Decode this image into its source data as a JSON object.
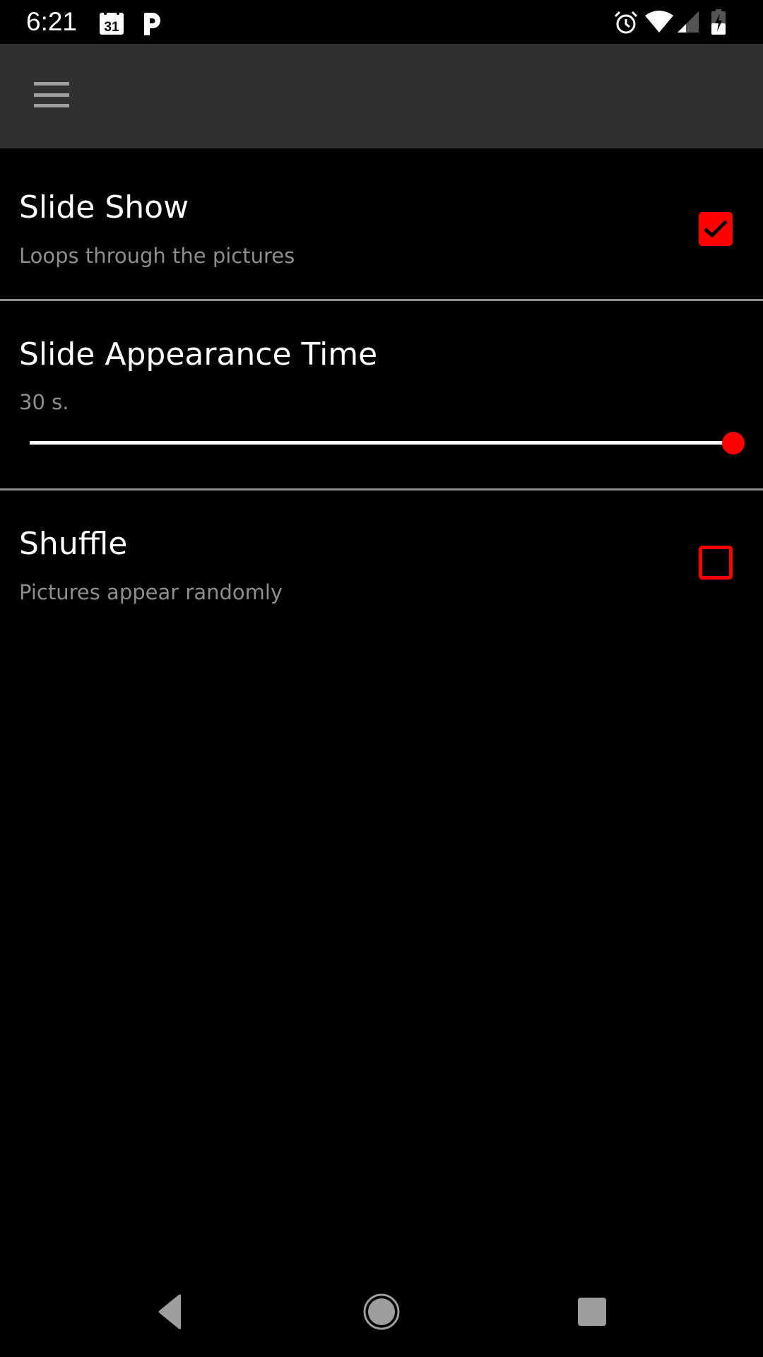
{
  "status_bar": {
    "time": "6:21",
    "left_icons": [
      "calendar-icon",
      "parking-icon"
    ],
    "calendar_day": "31",
    "right_icons": [
      "alarm-icon",
      "wifi-icon",
      "cellular-signal-icon",
      "battery-charging-icon"
    ]
  },
  "toolbar": {
    "menu_icon": "hamburger-menu-icon"
  },
  "preferences": [
    {
      "title": "Slide Show",
      "summary": "Loops through the pictures",
      "type": "checkbox",
      "checked": true
    },
    {
      "title": "Slide Appearance Time",
      "summary": "30 s.",
      "type": "slider",
      "value_fraction": 1.0
    },
    {
      "title": "Shuffle",
      "summary": "Pictures appear randomly",
      "type": "checkbox",
      "checked": false
    }
  ],
  "nav_bar": {
    "buttons": [
      "back-icon",
      "home-icon",
      "recents-icon"
    ]
  },
  "colors": {
    "accent": "#ff0000",
    "toolbar_bg": "#303030",
    "background": "#000000",
    "summary_text": "#8e8e8e",
    "divider": "#8e8e8e"
  }
}
